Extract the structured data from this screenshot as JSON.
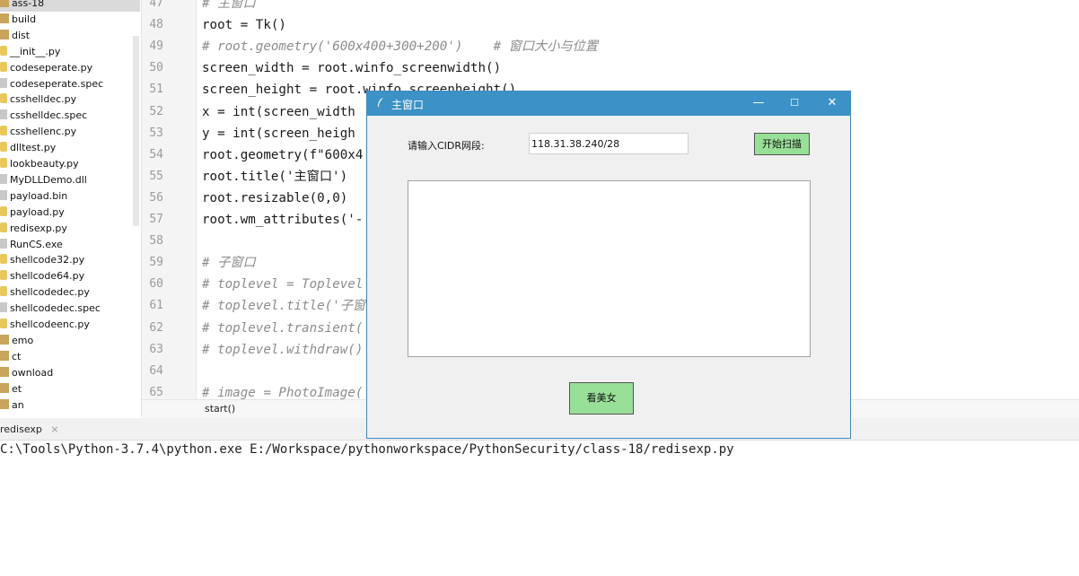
{
  "file_tree": {
    "items": [
      {
        "label": "ass-18",
        "icon": "folder-icon",
        "selected": true
      },
      {
        "label": "build",
        "icon": "folder-icon"
      },
      {
        "label": "dist",
        "icon": "folder-icon"
      },
      {
        "label": "__init__.py",
        "icon": "python-file-icon"
      },
      {
        "label": "codeseperate.py",
        "icon": "python-file-icon"
      },
      {
        "label": "codeseperate.spec",
        "icon": "file-icon"
      },
      {
        "label": "csshelldec.py",
        "icon": "python-file-icon"
      },
      {
        "label": "csshelldec.spec",
        "icon": "file-icon"
      },
      {
        "label": "csshellenc.py",
        "icon": "python-file-icon"
      },
      {
        "label": "dlltest.py",
        "icon": "python-file-icon"
      },
      {
        "label": "lookbeauty.py",
        "icon": "python-file-icon"
      },
      {
        "label": "MyDLLDemo.dll",
        "icon": "file-icon"
      },
      {
        "label": "payload.bin",
        "icon": "file-icon"
      },
      {
        "label": "payload.py",
        "icon": "python-file-icon"
      },
      {
        "label": "redisexp.py",
        "icon": "python-file-icon"
      },
      {
        "label": "RunCS.exe",
        "icon": "file-icon"
      },
      {
        "label": "shellcode32.py",
        "icon": "python-file-icon"
      },
      {
        "label": "shellcode64.py",
        "icon": "python-file-icon"
      },
      {
        "label": "shellcodedec.py",
        "icon": "python-file-icon"
      },
      {
        "label": "shellcodedec.spec",
        "icon": "file-icon"
      },
      {
        "label": "shellcodeenc.py",
        "icon": "python-file-icon"
      },
      {
        "label": "emo",
        "icon": "folder-icon"
      },
      {
        "label": "ct",
        "icon": "folder-icon"
      },
      {
        "label": "ownload",
        "icon": "folder-icon"
      },
      {
        "label": "et",
        "icon": "folder-icon"
      },
      {
        "label": "an",
        "icon": "folder-icon"
      }
    ]
  },
  "editor": {
    "lines": [
      {
        "n": "47",
        "text": "# 主窗口",
        "comment": true
      },
      {
        "n": "48",
        "text": "root = Tk()",
        "comment": false
      },
      {
        "n": "49",
        "text": "# root.geometry('600x400+300+200')    # 窗口大小与位置",
        "comment": true
      },
      {
        "n": "50",
        "text": "screen_width = root.winfo_screenwidth()",
        "comment": false
      },
      {
        "n": "51",
        "text": "screen_height = root.winfo_screenheight()",
        "comment": false
      },
      {
        "n": "52",
        "text": "x = int(screen_width",
        "comment": false
      },
      {
        "n": "53",
        "text": "y = int(screen_heigh",
        "comment": false
      },
      {
        "n": "54",
        "text": "root.geometry(f\"600x4",
        "comment": false
      },
      {
        "n": "55",
        "text": "root.title('主窗口')",
        "comment": false
      },
      {
        "n": "56",
        "text": "root.resizable(0,0)",
        "comment": false
      },
      {
        "n": "57",
        "text": "root.wm_attributes('-",
        "comment": false
      },
      {
        "n": "58",
        "text": "",
        "comment": false
      },
      {
        "n": "59",
        "text": "# 子窗口",
        "comment": true
      },
      {
        "n": "60",
        "text": "# toplevel = Toplevel",
        "comment": true
      },
      {
        "n": "61",
        "text": "# toplevel.title('子窗",
        "comment": true
      },
      {
        "n": "62",
        "text": "# toplevel.transient(",
        "comment": true
      },
      {
        "n": "63",
        "text": "# toplevel.withdraw()",
        "comment": true
      },
      {
        "n": "64",
        "text": "",
        "comment": false
      },
      {
        "n": "65",
        "text": "# image = PhotoImage(",
        "comment": true
      }
    ],
    "breadcrumb": "start()"
  },
  "run": {
    "tab_label": "redisexp",
    "tab_close": "×",
    "console_line": "C:\\Tools\\Python-3.7.4\\python.exe E:/Workspace/pythonworkspace/PythonSecurity/class-18/redisexp.py"
  },
  "dialog": {
    "title": "主窗口",
    "title_icon": "feather-icon",
    "minimize": "—",
    "maximize": "☐",
    "close": "✕",
    "cidr_label": "请输入CIDR网段:",
    "cidr_value": "118.31.38.240/28",
    "scan_button": "开始扫描",
    "beauty_button": "看美女",
    "output_text": "",
    "button_color": "#98df98",
    "title_color": "#3c92c6"
  }
}
